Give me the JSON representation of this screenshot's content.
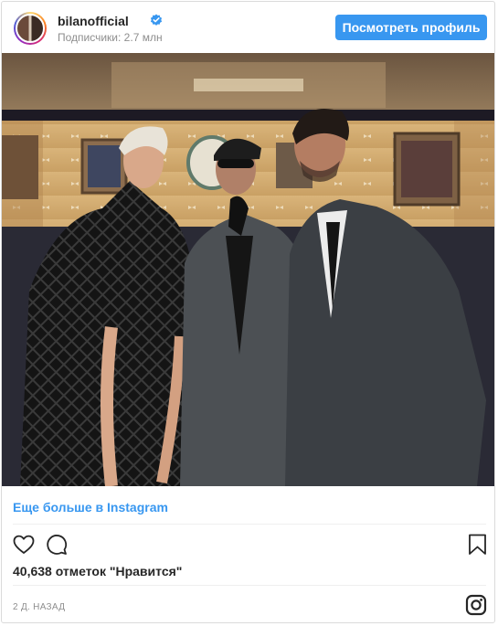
{
  "header": {
    "username": "bilanofficial",
    "subscribers": "Подписчики: 2.7 млн",
    "view_profile_label": "Посмотреть профиль"
  },
  "post": {
    "more_link": "Еще больше в Instagram",
    "likes": "40,638 отметок \"Нравится\"",
    "time_ago": "2 Д. НАЗАД"
  },
  "icons": {
    "verified": "verified-badge-icon",
    "like": "heart-icon",
    "comment": "comment-icon",
    "save": "bookmark-icon",
    "instagram": "instagram-logo-icon"
  },
  "colors": {
    "accent": "#3897f0",
    "text": "#262626",
    "muted": "#8e8e8e",
    "border": "#dbdbdb"
  }
}
